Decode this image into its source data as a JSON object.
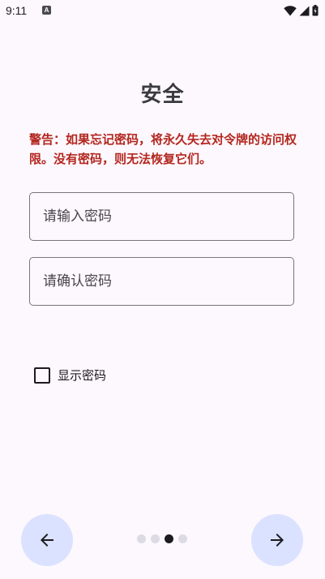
{
  "status_bar": {
    "time": "9:11",
    "notification_icon_letter": "A",
    "icons": [
      "wifi-icon",
      "cellular-signal-icon",
      "battery-icon"
    ]
  },
  "page": {
    "title": "安全",
    "warning": "警告：如果忘记密码，将永久失去对令牌的访问权限。没有密码，则无法恢复它们。"
  },
  "form": {
    "password": {
      "value": "",
      "placeholder": "请输入密码"
    },
    "confirm_password": {
      "value": "",
      "placeholder": "请确认密码"
    },
    "show_password": {
      "label": "显示密码",
      "checked": false
    }
  },
  "navigation": {
    "back_icon": "arrow-left-icon",
    "next_icon": "arrow-right-icon",
    "page_count": 4,
    "current_page": 3
  },
  "colors": {
    "background": "#fdf8fd",
    "warning": "#b3261e",
    "nav_button": "#dae2ff",
    "active_dot": "#1c1b1f",
    "inactive_dot": "#dcdbe3"
  }
}
